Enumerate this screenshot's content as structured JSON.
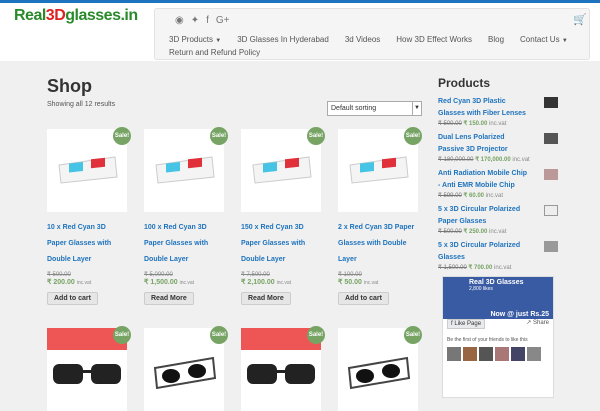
{
  "header": {
    "logo": {
      "part1": "Real",
      "part2": "3D",
      "part3": "glasses.in"
    },
    "menu": [
      {
        "label": "3D Products",
        "caret": true
      },
      {
        "label": "3D Glasses In Hyderabad",
        "caret": false
      },
      {
        "label": "3d Videos",
        "caret": false
      },
      {
        "label": "How 3D Effect Works",
        "caret": false
      },
      {
        "label": "Blog",
        "caret": false
      },
      {
        "label": "Contact Us",
        "caret": true
      },
      {
        "label": "Return and Refund Policy",
        "caret": false
      }
    ]
  },
  "shop": {
    "title": "Shop",
    "result_count": "Showing all 12 results",
    "sort_value": "Default sorting",
    "sale_badge": "Sale!",
    "products": [
      {
        "name": "10 x Red Cyan 3D Paper Glasses with Double Layer",
        "old_price": "₹ 500.00",
        "price": "₹ 200.00",
        "tax": "inc.vat",
        "button": "Add to cart"
      },
      {
        "name": "100 x Red Cyan 3D Paper Glasses with Double Layer",
        "old_price": "₹ 5,000.00",
        "price": "₹ 1,500.00",
        "tax": "inc.vat",
        "button": "Read More"
      },
      {
        "name": "150 x Red Cyan 3D Paper Glasses with Double Layer",
        "old_price": "₹ 7,500.00",
        "price": "₹ 2,100.00",
        "tax": "inc.vat",
        "button": "Read More"
      },
      {
        "name": "2 x Red Cyan 3D Paper Glasses with Double Layer",
        "old_price": "₹ 100.00",
        "price": "₹ 50.00",
        "tax": "inc.vat",
        "button": "Add to cart"
      }
    ]
  },
  "sidebar": {
    "title": "Products",
    "items": [
      {
        "name": "Red Cyan 3D Plastic Glasses with Fiber Lenses",
        "old": "₹ 500.00",
        "price": "₹ 150.00",
        "tax": "inc.vat"
      },
      {
        "name": "Dual Lens Polarized Passive 3D Projector",
        "old": "₹ 180,000.00",
        "price": "₹ 170,000.00",
        "tax": "inc.vat"
      },
      {
        "name": "Anti Radiation Mobile Chip - Anti EMR Mobile Chip",
        "old": "₹ 599.00",
        "price": "₹ 60.00",
        "tax": "inc.vat"
      },
      {
        "name": "5 x 3D Circular Polarized Paper Glasses",
        "old": "₹ 500.00",
        "price": "₹ 250.00",
        "tax": "inc.vat"
      },
      {
        "name": "5 x 3D Circular Polarized Glasses",
        "old": "₹ 1,500.00",
        "price": "₹ 700.00",
        "tax": "inc.vat"
      }
    ]
  },
  "facebook": {
    "page_name": "Real 3D Glasses",
    "likes": "2,800 likes",
    "promo": "Now @ just Rs.25",
    "like_button": "Like Page",
    "share": "Share",
    "first_friends": "Be the first of your friends to like this"
  }
}
